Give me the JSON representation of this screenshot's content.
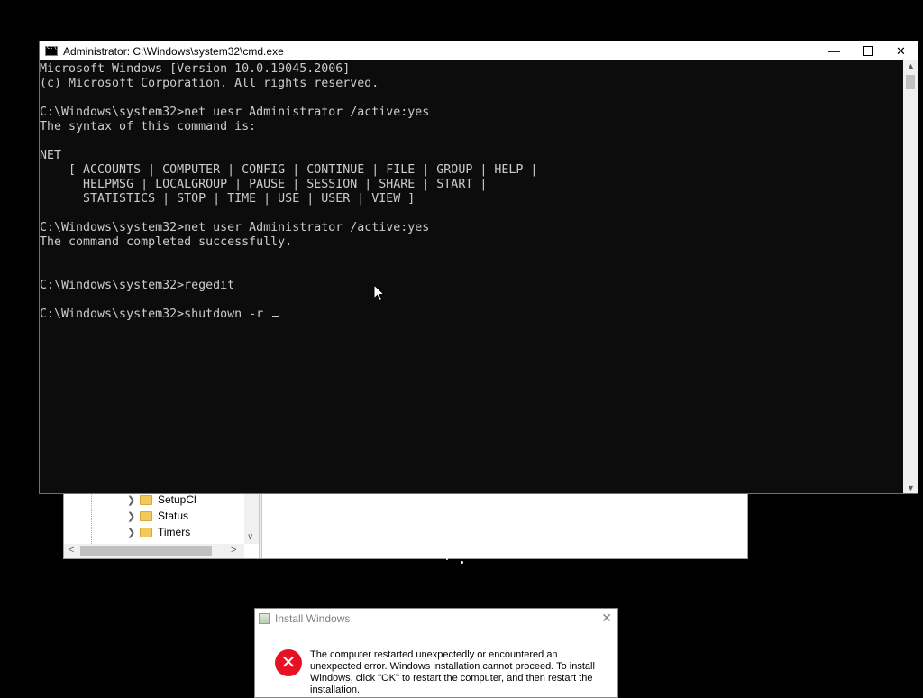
{
  "regedit": {
    "tree_items": [
      {
        "label": "SetupCl"
      },
      {
        "label": "Status"
      },
      {
        "label": "Timers"
      }
    ]
  },
  "cmd": {
    "title": "Administrator: C:\\Windows\\system32\\cmd.exe",
    "output": "Microsoft Windows [Version 10.0.19045.2006]\n(c) Microsoft Corporation. All rights reserved.\n\nC:\\Windows\\system32>net uesr Administrator /active:yes\nThe syntax of this command is:\n\nNET\n    [ ACCOUNTS | COMPUTER | CONFIG | CONTINUE | FILE | GROUP | HELP |\n      HELPMSG | LOCALGROUP | PAUSE | SESSION | SHARE | START |\n      STATISTICS | STOP | TIME | USE | USER | VIEW ]\n\nC:\\Windows\\system32>net user Administrator /active:yes\nThe command completed successfully.\n\n\nC:\\Windows\\system32>regedit\n\nC:\\Windows\\system32>shutdown -r ",
    "buttons": {
      "minimize": "—",
      "close": "✕"
    }
  },
  "dialog": {
    "title": "Install Windows",
    "close": "✕",
    "message": "The computer restarted unexpectedly or encountered an unexpected error. Windows installation cannot proceed. To install Windows, click \"OK\" to restart the computer, and then restart the installation."
  },
  "colors": {
    "console_bg": "#0c0c0c",
    "console_fg": "#cccccc",
    "error_red": "#e81123"
  }
}
